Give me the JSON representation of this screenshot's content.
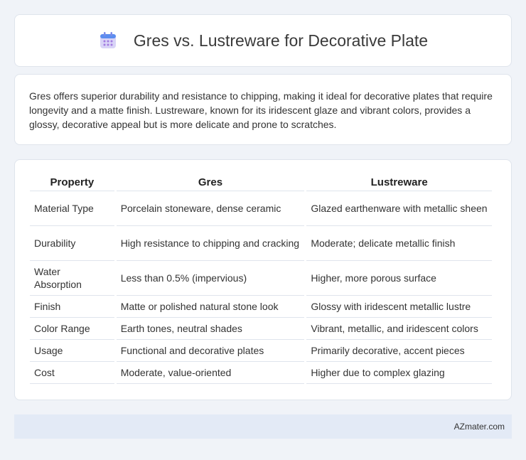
{
  "header": {
    "title": "Gres vs. Lustreware for Decorative Plate",
    "icon": "calendar-icon"
  },
  "intro": {
    "text": "Gres offers superior durability and resistance to chipping, making it ideal for decorative plates that require longevity and a matte finish. Lustreware, known for its iridescent glaze and vibrant colors, provides a glossy, decorative appeal but is more delicate and prone to scratches."
  },
  "table": {
    "headers": [
      "Property",
      "Gres",
      "Lustreware"
    ],
    "rows": [
      [
        "Material Type",
        "Porcelain stoneware, dense ceramic",
        "Glazed earthenware with metallic sheen"
      ],
      [
        "Durability",
        "High resistance to chipping and cracking",
        "Moderate; delicate metallic finish"
      ],
      [
        "Water Absorption",
        "Less than 0.5% (impervious)",
        "Higher, more porous surface"
      ],
      [
        "Finish",
        "Matte or polished natural stone look",
        "Glossy with iridescent metallic lustre"
      ],
      [
        "Color Range",
        "Earth tones, neutral shades",
        "Vibrant, metallic, and iridescent colors"
      ],
      [
        "Usage",
        "Functional and decorative plates",
        "Primarily decorative, accent pieces"
      ],
      [
        "Cost",
        "Moderate, value-oriented",
        "Higher due to complex glazing"
      ]
    ]
  },
  "footer": {
    "brand": "AZmater.com"
  }
}
